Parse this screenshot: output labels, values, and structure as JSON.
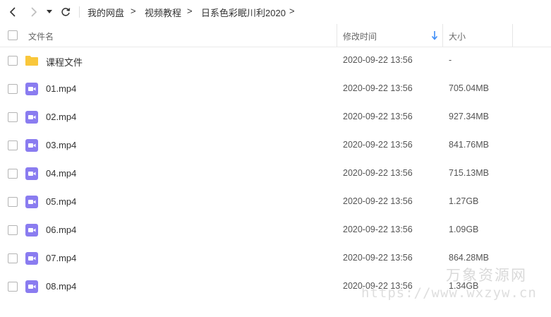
{
  "breadcrumb": {
    "items": [
      "我的网盘",
      "视频教程",
      "日系色彩眠川利2020"
    ],
    "separator": ">"
  },
  "columns": {
    "name": "文件名",
    "modified": "修改时间",
    "size": "大小"
  },
  "files": [
    {
      "name": "课程文件",
      "type": "folder",
      "modified": "2020-09-22 13:56",
      "size": "-"
    },
    {
      "name": "01.mp4",
      "type": "video",
      "modified": "2020-09-22 13:56",
      "size": "705.04MB"
    },
    {
      "name": "02.mp4",
      "type": "video",
      "modified": "2020-09-22 13:56",
      "size": "927.34MB"
    },
    {
      "name": "03.mp4",
      "type": "video",
      "modified": "2020-09-22 13:56",
      "size": "841.76MB"
    },
    {
      "name": "04.mp4",
      "type": "video",
      "modified": "2020-09-22 13:56",
      "size": "715.13MB"
    },
    {
      "name": "05.mp4",
      "type": "video",
      "modified": "2020-09-22 13:56",
      "size": "1.27GB"
    },
    {
      "name": "06.mp4",
      "type": "video",
      "modified": "2020-09-22 13:56",
      "size": "1.09GB"
    },
    {
      "name": "07.mp4",
      "type": "video",
      "modified": "2020-09-22 13:56",
      "size": "864.28MB"
    },
    {
      "name": "08.mp4",
      "type": "video",
      "modified": "2020-09-22 13:56",
      "size": "1.34GB"
    }
  ],
  "watermark": {
    "title": "万象资源网",
    "url": "https://www.wxzyw.cn"
  },
  "colors": {
    "folder": "#f9c73b",
    "video": "#8a7cf0",
    "sort_arrow": "#3f8ef7"
  },
  "icons": [
    "back-arrow-icon",
    "forward-arrow-icon",
    "dropdown-caret-icon",
    "refresh-icon",
    "folder-icon",
    "video-file-icon",
    "sort-down-arrow-icon"
  ]
}
